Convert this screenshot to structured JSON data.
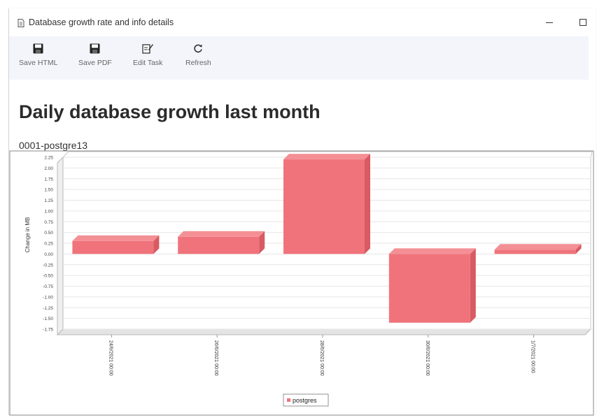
{
  "window": {
    "title": "Database growth rate and info details"
  },
  "toolbar": {
    "items": [
      {
        "label": "Save HTML",
        "icon": "floppy-disk-icon"
      },
      {
        "label": "Save PDF",
        "icon": "floppy-disk-icon"
      },
      {
        "label": "Edit Task",
        "icon": "edit-task-icon"
      },
      {
        "label": "Refresh",
        "icon": "refresh-icon"
      }
    ]
  },
  "report": {
    "heading": "Daily database growth last month",
    "subheading": "0001-postgre13"
  },
  "chart_data": {
    "type": "bar",
    "title": "",
    "ylabel": "Change in MB",
    "xlabel": "",
    "categories": [
      "24/6/2021 00:00",
      "26/6/2021 00:00",
      "28/6/2021 00:00",
      "30/6/2021 00:00",
      "1/7/2021 00:00"
    ],
    "series": [
      {
        "name": "postgres",
        "values": [
          0.3,
          0.4,
          2.2,
          -1.6,
          0.1
        ],
        "color": "#f0737b"
      }
    ],
    "ylim": [
      -1.75,
      2.25
    ],
    "yticks": [
      "2.25",
      "2.00",
      "1.75",
      "1.50",
      "1.25",
      "1.00",
      "0.75",
      "0.50",
      "0.25",
      "0.00",
      "-0.25",
      "-0.50",
      "-0.75",
      "-1.00",
      "-1.25",
      "-1.50",
      "-1.75"
    ],
    "legend_position": "bottom-center",
    "grid": true,
    "three_d": true
  }
}
